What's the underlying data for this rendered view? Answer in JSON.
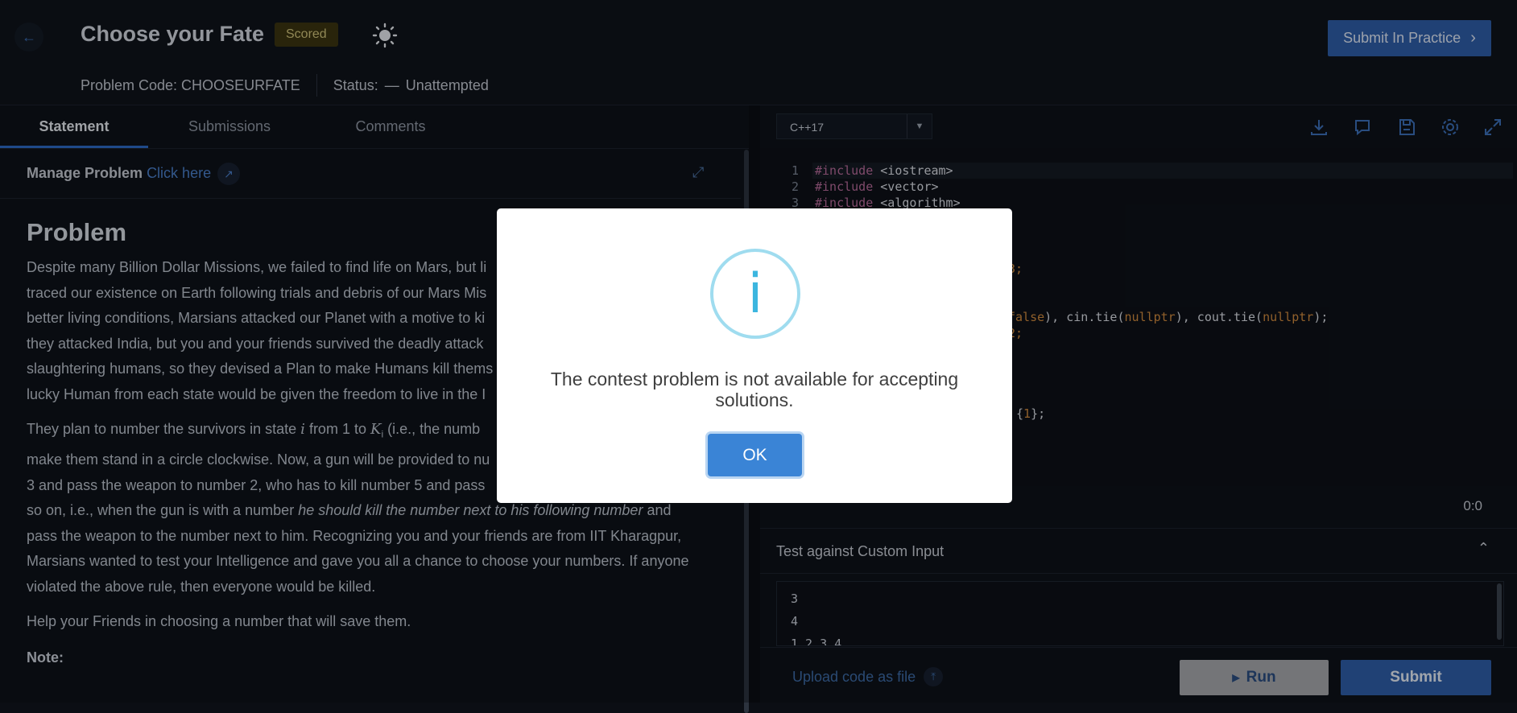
{
  "header": {
    "back_icon": "arrow-left-icon",
    "title": "Choose your Fate",
    "badge": "Scored",
    "theme_icon": "sun-icon",
    "problem_code_label": "Problem Code: CHOOSEURFATE",
    "status_label": "Status:",
    "status_dash": "—",
    "status_value": "Unattempted",
    "submit_practice": "Submit In Practice"
  },
  "left": {
    "tabs": [
      "Statement",
      "Submissions",
      "Comments"
    ],
    "manage_label": "Manage Problem",
    "manage_link": "Click here",
    "heading": "Problem",
    "paragraphs": [
      "Despite many Billion Dollar Missions, we failed to find life on Mars, but li",
      "traced our existence on Earth following trials and debris of our Mars Mis",
      "better living conditions, Marsians attacked our Planet with a motive to ki",
      "they attacked India, but you and your friends survived the deadly attack",
      "slaughtering humans, so they devised a Plan to make Humans kill thems",
      "lucky Human from each state would be given the freedom to live in the I"
    ],
    "para2_line1_a": "They plan to number the survivors in state ",
    "para2_line1_var": "i",
    "para2_line1_b": " from ",
    "para2_line1_n1": "1",
    "para2_line1_c": " to ",
    "para2_line1_var2": "K",
    "para2_line1_sub": "i",
    "para2_line1_d": " (i.e., the numb",
    "para2_line2": "make them stand in a circle clockwise. Now, a gun will be provided to nu",
    "para2_line3_n": "3",
    "para2_line3_a": " and pass the weapon to number ",
    "para2_line3_n2": "2",
    "para2_line3_b": ", who has to kill number ",
    "para2_line3_n3": "5",
    "para2_line3_c": " and pass",
    "para2_line4_a": "so on, i.e., when the gun is with a number ",
    "para2_line4_em": "he should kill the number next to his following number",
    "para2_line4_b": " and",
    "para2_line5": "pass the weapon to the number next to him. Recognizing you and your friends are from IIT Kharagpur,",
    "para2_line6": "Marsians wanted to test your Intelligence and gave you all a chance to choose your numbers. If anyone",
    "para2_line7": "violated the above rule, then everyone would be killed.",
    "para3": "Help your Friends in choosing a number that will save them.",
    "note": "Note:"
  },
  "right": {
    "language": "C++17",
    "toolbar_icons": [
      "download-icon",
      "comment-icon",
      "save-icon",
      "settings-icon",
      "fullscreen-icon"
    ],
    "code": {
      "line1_kw": "#include",
      "line1_rest": " <iostream>",
      "line2_kw": "#include",
      "line2_rest": " <vector>",
      "line3_kw": "#include",
      "line3_rest": " <algorithm>",
      "line4_tail": "3;",
      "line5_false": "false",
      "line5_mid": "), cin.tie(",
      "line5_null1": "nullptr",
      "line5_mid2": "), cout.tie(",
      "line5_null2": "nullptr",
      "line5_end": ");",
      "line6_tail": "2;",
      "line7_open": "{",
      "line7_num": "1",
      "line7_close": "};"
    },
    "line_numbers": [
      "1",
      "2",
      "3"
    ],
    "timer": "0:0",
    "custom_input_label": "Test against Custom Input",
    "custom_input_lines": [
      "3",
      "4",
      "1 2 3 4"
    ],
    "upload_label": "Upload code as file",
    "run_label": "Run",
    "submit_label": "Submit"
  },
  "modal": {
    "icon": "info-icon",
    "icon_glyph": "i",
    "message": "The contest problem is not available for accepting solutions.",
    "ok_label": "OK"
  },
  "colors": {
    "accent": "#2f5da8",
    "modal_icon": "#3cb6df",
    "ok_button": "#3a84d6"
  }
}
